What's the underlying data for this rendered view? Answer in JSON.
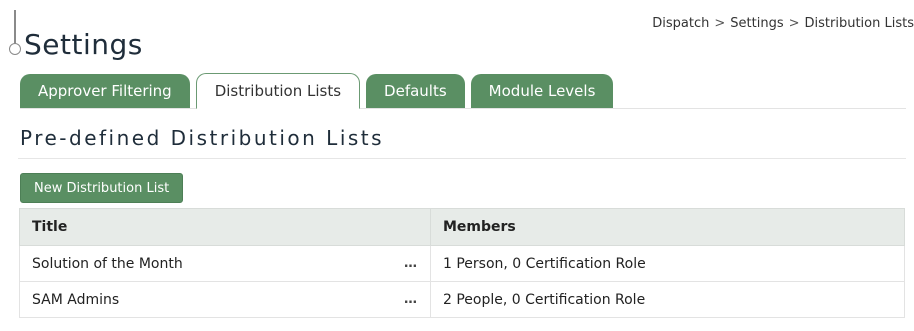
{
  "page": {
    "title": "Settings"
  },
  "breadcrumb": {
    "items": [
      "Dispatch",
      "Settings",
      "Distribution Lists"
    ],
    "separator": ">"
  },
  "tabs": [
    {
      "label": "Approver Filtering",
      "active": false
    },
    {
      "label": "Distribution Lists",
      "active": true
    },
    {
      "label": "Defaults",
      "active": false
    },
    {
      "label": "Module Levels",
      "active": false
    }
  ],
  "section": {
    "title": "Pre-defined Distribution Lists"
  },
  "actions": {
    "new_button": "New Distribution List"
  },
  "table": {
    "columns": [
      "Title",
      "Members"
    ],
    "rows": [
      {
        "title": "Solution of the Month",
        "menu": "…",
        "members": "1 Person, 0 Certification Role"
      },
      {
        "title": "SAM Admins",
        "menu": "…",
        "members": "2 People, 0 Certification Role"
      }
    ]
  },
  "colors": {
    "accent": "#5a8f63",
    "header_bg": "#e7ebe8"
  }
}
